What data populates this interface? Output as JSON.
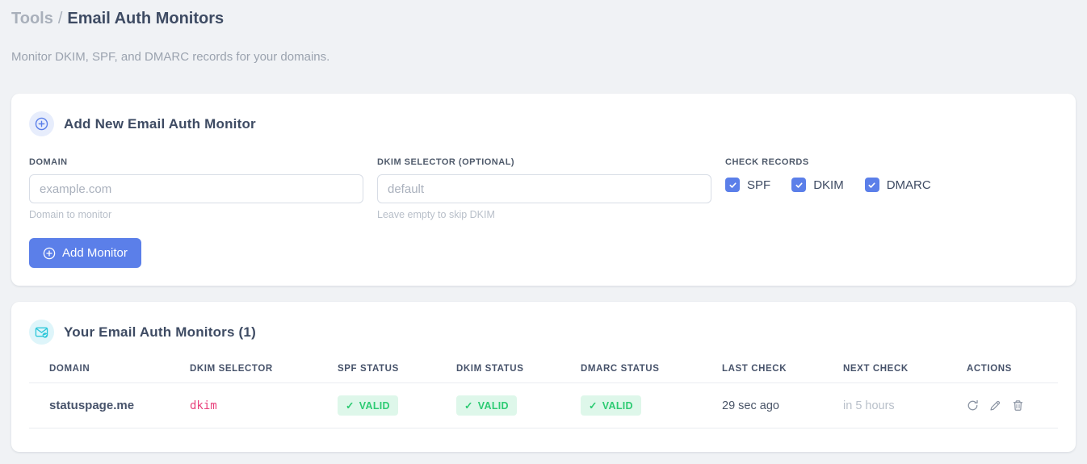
{
  "header": {
    "breadcrumb_parent": "Tools",
    "breadcrumb_separator": "/",
    "title": "Email Auth Monitors",
    "subtitle": "Monitor DKIM, SPF, and DMARC records for your domains."
  },
  "add_card": {
    "title": "Add New Email Auth Monitor",
    "fields": {
      "domain": {
        "label": "DOMAIN",
        "placeholder": "example.com",
        "value": "",
        "hint": "Domain to monitor"
      },
      "dkim_selector": {
        "label": "DKIM SELECTOR (OPTIONAL)",
        "placeholder": "default",
        "value": "",
        "hint": "Leave empty to skip DKIM"
      }
    },
    "check_records": {
      "label": "CHECK RECORDS",
      "options": [
        {
          "label": "SPF",
          "checked": true
        },
        {
          "label": "DKIM",
          "checked": true
        },
        {
          "label": "DMARC",
          "checked": true
        }
      ]
    },
    "submit_label": "Add Monitor"
  },
  "monitors_card": {
    "title": "Your Email Auth Monitors (1)",
    "count": "1",
    "table": {
      "columns": [
        "DOMAIN",
        "DKIM SELECTOR",
        "SPF STATUS",
        "DKIM STATUS",
        "DMARC STATUS",
        "LAST CHECK",
        "NEXT CHECK",
        "ACTIONS"
      ],
      "rows": [
        {
          "domain": "statuspage.me",
          "dkim_selector": "dkim",
          "spf_status": "VALID",
          "dkim_status": "VALID",
          "dmarc_status": "VALID",
          "last_check": "29 sec ago",
          "next_check": "in 5 hours"
        }
      ]
    }
  },
  "glyphs": {
    "check": "✓"
  },
  "icons": {
    "circle_plus": "⊕",
    "envelope_check": "✉✓",
    "checkbox_check": "✓",
    "refresh": "↻",
    "edit": "✎",
    "delete": "🗑"
  },
  "colors": {
    "accent_blue": "#5b7fe9",
    "badge_green_text": "#2dcb73",
    "badge_green_bg": "#def7ea",
    "code_pink": "#e8427c",
    "icon_cyan": "#2cc7d9",
    "page_bg": "#f0f2f5",
    "heading_dark": "#3e4b63"
  }
}
